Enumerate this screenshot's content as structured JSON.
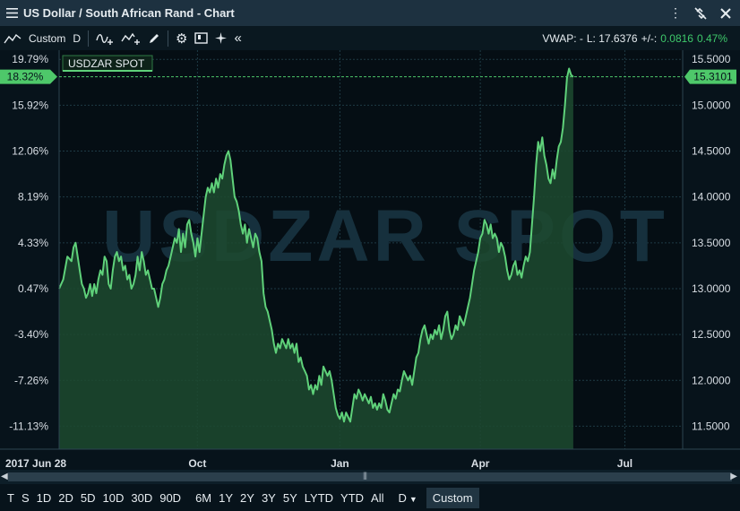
{
  "window": {
    "title": "US Dollar / South African Rand - Chart",
    "menu_icon": "hamburger-icon",
    "unlink_icon": "unlink-icon",
    "close_icon": "close-icon"
  },
  "toolbar": {
    "chart_type_icon": "line-chart-icon",
    "chart_type_label": "Custom",
    "interval_label": "D",
    "vwap_label": "VWAP: -",
    "last_label": "L: 17.6376",
    "change_label": "+/-:",
    "change_value": "0.0816",
    "change_pct": "0.47%"
  },
  "chart_data": {
    "type": "area",
    "instrument_label": "USDZAR SPOT",
    "watermark": "USDZAR SPOT",
    "x_tick_labels": [
      "2017 Jun 28",
      "Oct",
      "Jan",
      "Apr",
      "Jul"
    ],
    "x_tick_positions": [
      0,
      67,
      136,
      204,
      274
    ],
    "x_range": [
      0,
      302
    ],
    "right_axis": {
      "ticks": [
        11.5,
        12.0,
        12.5,
        13.0,
        13.5,
        14.0,
        14.5,
        15.0,
        15.5
      ],
      "tick_labels": [
        "11.5000",
        "12.0000",
        "12.5000",
        "13.0000",
        "13.5000",
        "14.0000",
        "14.5000",
        "15.0000",
        "15.5000"
      ],
      "ylim": [
        11.25,
        15.6
      ]
    },
    "left_axis": {
      "tick_labels": [
        "19.79%",
        "15.92%",
        "12.06%",
        "8.19%",
        "4.33%",
        "0.47%",
        "-3.40%",
        "-7.26%",
        "-11.13%"
      ]
    },
    "current_value": 15.3101,
    "current_value_label": "15.3101",
    "current_pct_label": "18.32%",
    "series": [
      {
        "values": [
          [
            0,
            13.0
          ],
          [
            2,
            13.1
          ],
          [
            4,
            13.35
          ],
          [
            6,
            13.3
          ],
          [
            7,
            13.45
          ],
          [
            8,
            13.5
          ],
          [
            9,
            13.35
          ],
          [
            10,
            13.2
          ],
          [
            11,
            13.05
          ],
          [
            12,
            13.0
          ],
          [
            13,
            12.9
          ],
          [
            14,
            12.95
          ],
          [
            15,
            13.05
          ],
          [
            16,
            12.92
          ],
          [
            17,
            13.05
          ],
          [
            18,
            12.95
          ],
          [
            19,
            13.1
          ],
          [
            20,
            13.2
          ],
          [
            21,
            13.15
          ],
          [
            22,
            13.35
          ],
          [
            23,
            13.3
          ],
          [
            24,
            13.05
          ],
          [
            25,
            13.0
          ],
          [
            26,
            13.2
          ],
          [
            27,
            13.35
          ],
          [
            28,
            13.4
          ],
          [
            29,
            13.3
          ],
          [
            30,
            13.35
          ],
          [
            31,
            13.2
          ],
          [
            32,
            13.25
          ],
          [
            33,
            13.1
          ],
          [
            34,
            13.15
          ],
          [
            35,
            13.0
          ],
          [
            36,
            13.05
          ],
          [
            37,
            13.15
          ],
          [
            38,
            13.35
          ],
          [
            39,
            13.2
          ],
          [
            40,
            13.4
          ],
          [
            41,
            13.3
          ],
          [
            42,
            13.15
          ],
          [
            43,
            13.2
          ],
          [
            44,
            13.1
          ],
          [
            45,
            13.0
          ],
          [
            46,
            13.0
          ],
          [
            47,
            12.9
          ],
          [
            48,
            12.8
          ],
          [
            49,
            12.9
          ],
          [
            50,
            13.05
          ],
          [
            51,
            13.1
          ],
          [
            52,
            13.2
          ],
          [
            53,
            13.25
          ],
          [
            54,
            13.35
          ],
          [
            55,
            13.45
          ],
          [
            56,
            13.55
          ],
          [
            57,
            13.5
          ],
          [
            58,
            13.65
          ],
          [
            59,
            13.4
          ],
          [
            60,
            13.6
          ],
          [
            61,
            13.45
          ],
          [
            62,
            13.7
          ],
          [
            63,
            13.75
          ],
          [
            64,
            13.6
          ],
          [
            65,
            13.5
          ],
          [
            66,
            13.35
          ],
          [
            67,
            13.55
          ],
          [
            68,
            13.4
          ],
          [
            69,
            13.6
          ],
          [
            70,
            13.8
          ],
          [
            71,
            14.0
          ],
          [
            72,
            14.1
          ],
          [
            73,
            14.05
          ],
          [
            74,
            14.15
          ],
          [
            75,
            14.05
          ],
          [
            76,
            14.2
          ],
          [
            77,
            14.1
          ],
          [
            78,
            14.25
          ],
          [
            79,
            14.2
          ],
          [
            80,
            14.35
          ],
          [
            81,
            14.45
          ],
          [
            82,
            14.5
          ],
          [
            83,
            14.4
          ],
          [
            84,
            14.2
          ],
          [
            85,
            14.0
          ],
          [
            86,
            13.95
          ],
          [
            87,
            13.85
          ],
          [
            88,
            13.7
          ],
          [
            89,
            13.6
          ],
          [
            90,
            13.7
          ],
          [
            91,
            13.5
          ],
          [
            92,
            13.65
          ],
          [
            93,
            13.55
          ],
          [
            94,
            13.45
          ],
          [
            95,
            13.6
          ],
          [
            96,
            13.55
          ],
          [
            97,
            13.4
          ],
          [
            98,
            13.3
          ],
          [
            99,
            12.95
          ],
          [
            100,
            12.8
          ],
          [
            101,
            12.75
          ],
          [
            102,
            12.65
          ],
          [
            103,
            12.55
          ],
          [
            104,
            12.4
          ],
          [
            105,
            12.3
          ],
          [
            106,
            12.4
          ],
          [
            107,
            12.35
          ],
          [
            108,
            12.45
          ],
          [
            109,
            12.4
          ],
          [
            110,
            12.35
          ],
          [
            111,
            12.45
          ],
          [
            112,
            12.35
          ],
          [
            113,
            12.4
          ],
          [
            114,
            12.3
          ],
          [
            115,
            12.4
          ],
          [
            116,
            12.2
          ],
          [
            117,
            12.25
          ],
          [
            118,
            12.15
          ],
          [
            119,
            12.1
          ],
          [
            120,
            12.05
          ],
          [
            121,
            11.9
          ],
          [
            122,
            11.95
          ],
          [
            123,
            11.85
          ],
          [
            124,
            11.95
          ],
          [
            125,
            11.9
          ],
          [
            126,
            12.05
          ],
          [
            127,
            11.95
          ],
          [
            128,
            12.15
          ],
          [
            129,
            12.1
          ],
          [
            130,
            12.05
          ],
          [
            131,
            12.1
          ],
          [
            132,
            12.0
          ],
          [
            133,
            11.85
          ],
          [
            134,
            11.7
          ],
          [
            135,
            11.62
          ],
          [
            136,
            11.58
          ],
          [
            137,
            11.65
          ],
          [
            138,
            11.55
          ],
          [
            139,
            11.65
          ],
          [
            140,
            11.6
          ],
          [
            141,
            11.55
          ],
          [
            142,
            11.7
          ],
          [
            143,
            11.85
          ],
          [
            144,
            11.8
          ],
          [
            145,
            11.9
          ],
          [
            146,
            11.85
          ],
          [
            147,
            11.78
          ],
          [
            148,
            11.85
          ],
          [
            149,
            11.8
          ],
          [
            150,
            11.75
          ],
          [
            151,
            11.82
          ],
          [
            152,
            11.7
          ],
          [
            153,
            11.75
          ],
          [
            154,
            11.68
          ],
          [
            155,
            11.75
          ],
          [
            156,
            11.7
          ],
          [
            157,
            11.85
          ],
          [
            158,
            11.78
          ],
          [
            159,
            11.68
          ],
          [
            160,
            11.65
          ],
          [
            161,
            11.75
          ],
          [
            162,
            11.85
          ],
          [
            163,
            11.8
          ],
          [
            164,
            11.9
          ],
          [
            165,
            11.88
          ],
          [
            166,
            12.0
          ],
          [
            167,
            12.1
          ],
          [
            168,
            12.05
          ],
          [
            169,
            12.0
          ],
          [
            170,
            12.05
          ],
          [
            171,
            11.95
          ],
          [
            172,
            12.1
          ],
          [
            173,
            12.25
          ],
          [
            174,
            12.3
          ],
          [
            175,
            12.45
          ],
          [
            176,
            12.55
          ],
          [
            177,
            12.6
          ],
          [
            178,
            12.5
          ],
          [
            179,
            12.4
          ],
          [
            180,
            12.5
          ],
          [
            181,
            12.45
          ],
          [
            182,
            12.55
          ],
          [
            183,
            12.5
          ],
          [
            184,
            12.6
          ],
          [
            185,
            12.45
          ],
          [
            186,
            12.55
          ],
          [
            187,
            12.7
          ],
          [
            188,
            12.75
          ],
          [
            189,
            12.55
          ],
          [
            190,
            12.45
          ],
          [
            191,
            12.5
          ],
          [
            192,
            12.6
          ],
          [
            193,
            12.55
          ],
          [
            194,
            12.7
          ],
          [
            195,
            12.65
          ],
          [
            196,
            12.6
          ],
          [
            197,
            12.7
          ],
          [
            198,
            12.8
          ],
          [
            199,
            12.9
          ],
          [
            200,
            13.05
          ],
          [
            201,
            13.2
          ],
          [
            202,
            13.3
          ],
          [
            203,
            13.4
          ],
          [
            204,
            13.55
          ],
          [
            205,
            13.6
          ],
          [
            206,
            13.75
          ],
          [
            207,
            13.7
          ],
          [
            208,
            13.6
          ],
          [
            209,
            13.7
          ],
          [
            210,
            13.55
          ],
          [
            211,
            13.6
          ],
          [
            212,
            13.55
          ],
          [
            213,
            13.4
          ],
          [
            214,
            13.5
          ],
          [
            215,
            13.45
          ],
          [
            216,
            13.35
          ],
          [
            217,
            13.2
          ],
          [
            218,
            13.1
          ],
          [
            219,
            13.15
          ],
          [
            220,
            13.25
          ],
          [
            221,
            13.3
          ],
          [
            222,
            13.15
          ],
          [
            223,
            13.2
          ],
          [
            224,
            13.12
          ],
          [
            225,
            13.25
          ],
          [
            226,
            13.35
          ],
          [
            227,
            13.3
          ],
          [
            228,
            13.4
          ],
          [
            229,
            13.7
          ],
          [
            230,
            14.0
          ],
          [
            231,
            14.35
          ],
          [
            232,
            14.6
          ],
          [
            233,
            14.5
          ],
          [
            234,
            14.65
          ],
          [
            235,
            14.45
          ],
          [
            236,
            14.35
          ],
          [
            237,
            14.2
          ],
          [
            238,
            14.15
          ],
          [
            239,
            14.3
          ],
          [
            240,
            14.2
          ],
          [
            241,
            14.4
          ],
          [
            242,
            14.55
          ],
          [
            243,
            14.6
          ],
          [
            244,
            14.75
          ],
          [
            245,
            15.0
          ],
          [
            246,
            15.3
          ],
          [
            247,
            15.4
          ],
          [
            248,
            15.33
          ],
          [
            249,
            15.3101
          ]
        ]
      }
    ]
  },
  "scrollbar": {
    "left_arrow": "◀",
    "right_arrow": "▶"
  },
  "periods": [
    "T",
    "S",
    "1D",
    "2D",
    "5D",
    "10D",
    "30D",
    "90D",
    "6M",
    "1Y",
    "2Y",
    "3Y",
    "5Y",
    "LYTD",
    "YTD",
    "All",
    "D"
  ],
  "custom_label": "Custom",
  "colors": {
    "line": "#5fd17a",
    "fill": "#1d4a2f",
    "axis_bg": "#07131b",
    "plot_bg": "#050e14",
    "accent": "#4ec86a"
  }
}
